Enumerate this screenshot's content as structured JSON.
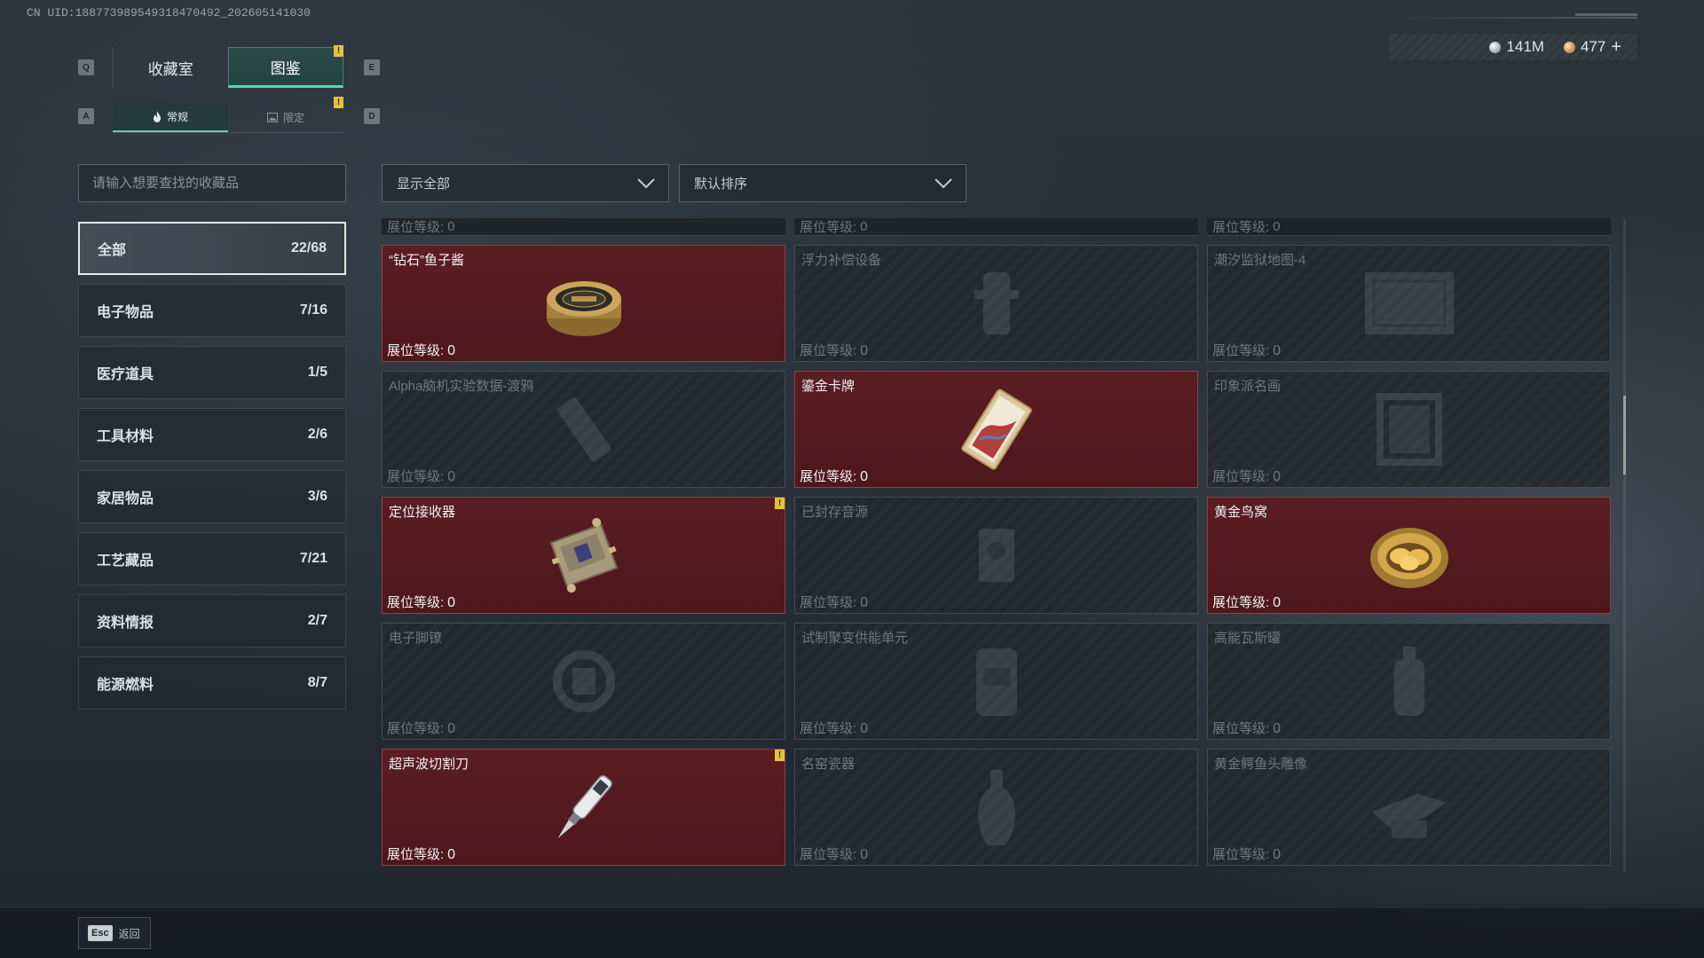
{
  "header": {
    "uid": "CN UID:188773989549318470492_202605141030",
    "currency": [
      {
        "icon": "silver-coin-icon",
        "value": "141M"
      },
      {
        "icon": "gold-coin-icon",
        "value": "477"
      }
    ],
    "plus_label": "+"
  },
  "tabs": {
    "prev_key": "Q",
    "next_key": "E",
    "items": [
      {
        "label": "收藏室",
        "active": false
      },
      {
        "label": "图鉴",
        "active": true,
        "badge": "!"
      }
    ]
  },
  "subtabs": {
    "prev_key": "A",
    "next_key": "D",
    "items": [
      {
        "label": "常规",
        "icon": "flame-icon",
        "active": true
      },
      {
        "label": "限定",
        "icon": "image-icon",
        "active": false,
        "badge": "!"
      }
    ]
  },
  "search": {
    "placeholder": "请输入想要查找的收藏品"
  },
  "filters": {
    "display": "显示全部",
    "sort": "默认排序"
  },
  "categories": [
    {
      "label": "全部",
      "count": "22/68",
      "active": true
    },
    {
      "label": "电子物品",
      "count": "7/16"
    },
    {
      "label": "医疗道具",
      "count": "1/5"
    },
    {
      "label": "工具材料",
      "count": "2/6"
    },
    {
      "label": "家居物品",
      "count": "3/6"
    },
    {
      "label": "工艺藏品",
      "count": "7/21"
    },
    {
      "label": "资料情报",
      "count": "2/7"
    },
    {
      "label": "能源燃料",
      "count": "8/7"
    }
  ],
  "level_label": "展位等级:",
  "partial_row": [
    {
      "level": "0"
    },
    {
      "level": "0"
    },
    {
      "level": "0"
    }
  ],
  "items": [
    {
      "name": "“钻石”鱼子酱",
      "level": "0",
      "owned": true,
      "art": "caviar-tin-icon"
    },
    {
      "name": "浮力补偿设备",
      "level": "0",
      "owned": false,
      "art": "buoyancy-device-icon"
    },
    {
      "name": "潮汐监狱地图-4",
      "level": "0",
      "owned": false,
      "art": "map-icon"
    },
    {
      "name": "Alpha脑机实验数据-渡鸦",
      "level": "0",
      "owned": false,
      "art": "data-drive-icon"
    },
    {
      "name": "鎏金卡牌",
      "level": "0",
      "owned": true,
      "art": "gilded-card-icon"
    },
    {
      "name": "印象派名画",
      "level": "0",
      "owned": false,
      "art": "painting-icon"
    },
    {
      "name": "定位接收器",
      "level": "0",
      "owned": true,
      "art": "locator-receiver-icon",
      "badge": "!"
    },
    {
      "name": "已封存音源",
      "level": "0",
      "owned": false,
      "art": "sealed-audio-icon"
    },
    {
      "name": "黄金鸟窝",
      "level": "0",
      "owned": true,
      "art": "golden-nest-icon"
    },
    {
      "name": "电子脚镣",
      "level": "0",
      "owned": false,
      "art": "ankle-monitor-icon"
    },
    {
      "name": "试制聚变供能单元",
      "level": "0",
      "owned": false,
      "art": "fusion-cell-icon"
    },
    {
      "name": "高能瓦斯罐",
      "level": "0",
      "owned": false,
      "art": "gas-canister-icon"
    },
    {
      "name": "超声波切割刀",
      "level": "0",
      "owned": true,
      "art": "ultrasonic-knife-icon",
      "badge": "!"
    },
    {
      "name": "名窑瓷器",
      "level": "0",
      "owned": false,
      "art": "porcelain-vase-icon"
    },
    {
      "name": "黄金鳄鱼头雕像",
      "level": "0",
      "owned": false,
      "art": "gold-croc-statue-icon"
    }
  ],
  "scroll": {
    "position": 0.27,
    "visible_fraction": 0.12
  },
  "footer": {
    "esc_key": "Esc",
    "back_label": "返回"
  },
  "colors": {
    "accent": "#5ed1b4",
    "owned_card": "#5a1d22",
    "warning_badge": "#e6c13f"
  }
}
